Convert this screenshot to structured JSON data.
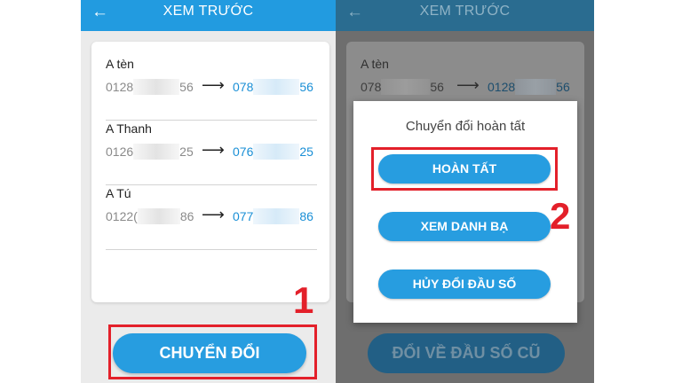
{
  "left": {
    "header": {
      "back_icon": "arrow-left-icon",
      "back_glyph": "←",
      "title": "XEM TRƯỚC"
    },
    "contacts": [
      {
        "name": "A tèn",
        "old_prefix": "0128",
        "old_suffix": "56",
        "arrow": "⟶",
        "new_prefix": "078",
        "new_suffix": "56"
      },
      {
        "name": "A Thanh",
        "old_prefix": "0126",
        "old_suffix": "25",
        "arrow": "⟶",
        "new_prefix": "076",
        "new_suffix": "25"
      },
      {
        "name": "A Tú",
        "old_prefix": "0122(",
        "old_suffix": "86",
        "arrow": "⟶",
        "new_prefix": "077",
        "new_suffix": "86"
      }
    ],
    "convert_button": "CHUYỂN ĐỔI",
    "step_label": "1"
  },
  "right": {
    "header": {
      "back_icon": "arrow-left-icon",
      "back_glyph": "←",
      "title": "XEM TRƯỚC"
    },
    "contact": {
      "name": "A tèn",
      "old_prefix": "078",
      "old_suffix": "56",
      "arrow": "⟶",
      "new_prefix": "0128",
      "new_suffix": "56"
    },
    "dialog": {
      "title": "Chuyển đổi hoàn tất",
      "done_button": "HOÀN TẤT",
      "view_contacts_button": "XEM DANH BẠ",
      "cancel_button": "HỦY ĐỔI ĐẦU SỐ"
    },
    "revert_button": "ĐỔI VỀ ĐẦU SỐ CŨ",
    "step_label": "2"
  },
  "colors": {
    "accent": "#279de0",
    "header": "#229be0",
    "highlight": "#e3202a"
  }
}
